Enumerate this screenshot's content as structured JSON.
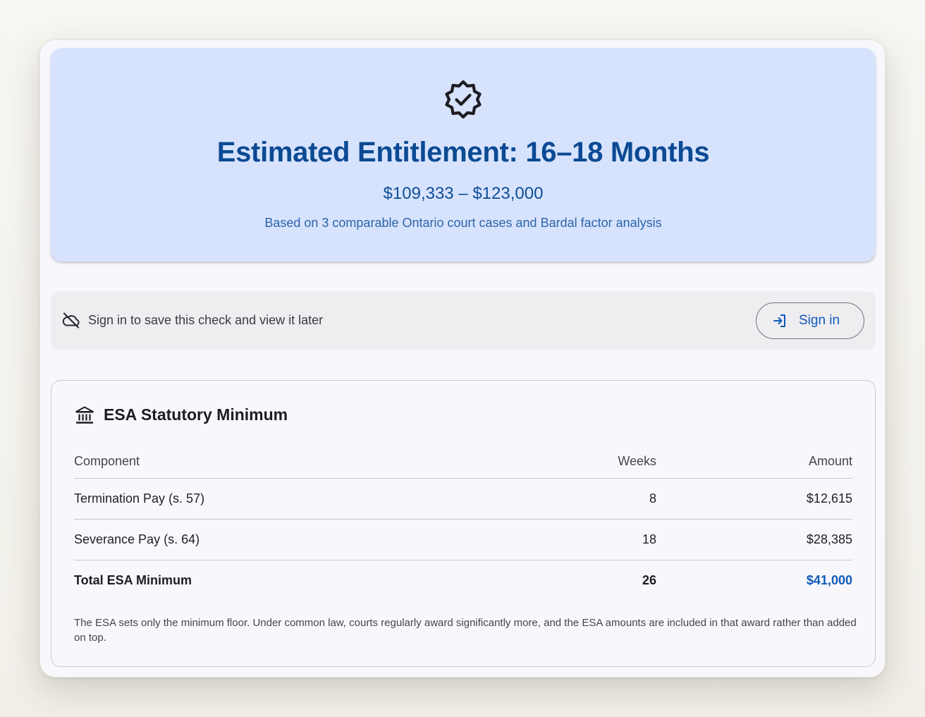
{
  "hero": {
    "icon": "verified-badge-icon",
    "title": "Estimated Entitlement: 16–18 Months",
    "range": "$109,333 – $123,000",
    "basis": "Based on 3 comparable Ontario court cases and Bardal factor analysis"
  },
  "signin": {
    "icon": "cloud-off-icon",
    "message": "Sign in to save this check and view it later",
    "button_label": "Sign in",
    "button_icon": "login-icon"
  },
  "esa": {
    "icon": "bank-icon",
    "title": "ESA Statutory Minimum",
    "columns": [
      "Component",
      "Weeks",
      "Amount"
    ],
    "rows": [
      {
        "component": "Termination Pay (s. 57)",
        "weeks": "8",
        "amount": "$12,615"
      },
      {
        "component": "Severance Pay (s. 64)",
        "weeks": "18",
        "amount": "$28,385"
      }
    ],
    "total": {
      "label": "Total ESA Minimum",
      "weeks": "26",
      "amount": "$41,000"
    },
    "note": "The ESA sets only the minimum floor. Under common law, courts regularly award significantly more, and the ESA amounts are included in that award rather than added on top."
  },
  "colors": {
    "accent": "#0e5ab8",
    "hero_bg": "#d7e3fd",
    "hero_title": "#0b4a93"
  }
}
